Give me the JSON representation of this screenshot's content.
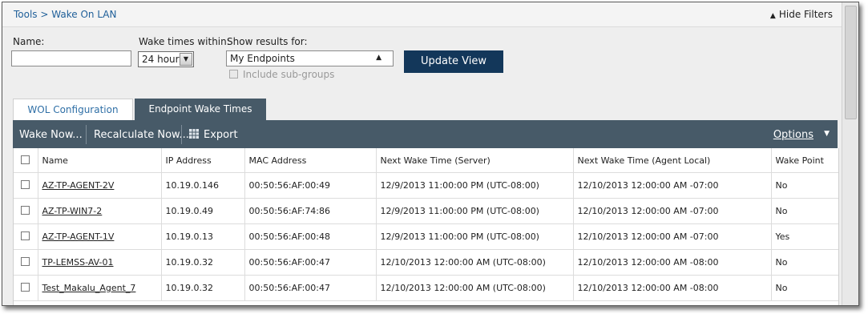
{
  "breadcrumb": {
    "parent": "Tools",
    "separator": ">",
    "current": "Wake On LAN"
  },
  "header": {
    "hide_filters_label": "Hide Filters"
  },
  "filters": {
    "name_label": "Name:",
    "name_value": "",
    "wake_times_label": "Wake times within:",
    "wake_times_value": "24 hours",
    "show_results_label": "Show results for:",
    "show_results_value": "My Endpoints",
    "include_subgroups_label": "Include sub-groups",
    "update_button_label": "Update View"
  },
  "tabs": [
    {
      "label": "WOL Configuration",
      "active": false
    },
    {
      "label": "Endpoint Wake Times",
      "active": true
    }
  ],
  "toolbar": {
    "wake_now_label": "Wake Now...",
    "recalculate_label": "Recalculate Now...",
    "export_label": "Export",
    "options_label": "Options"
  },
  "table": {
    "columns": [
      "Name",
      "IP Address",
      "MAC Address",
      "Next Wake Time (Server)",
      "Next Wake Time (Agent Local)",
      "Wake Point"
    ],
    "rows": [
      [
        "AZ-TP-AGENT-2V",
        "10.19.0.146",
        "00:50:56:AF:00:49",
        "12/9/2013 11:00:00 PM (UTC-08:00)",
        "12/10/2013 12:00:00 AM -07:00",
        "No"
      ],
      [
        "AZ-TP-WIN7-2",
        "10.19.0.49",
        "00:50:56:AF:74:86",
        "12/9/2013 11:00:00 PM (UTC-08:00)",
        "12/10/2013 12:00:00 AM -07:00",
        "No"
      ],
      [
        "AZ-TP-AGENT-1V",
        "10.19.0.13",
        "00:50:56:AF:00:48",
        "12/9/2013 11:00:00 PM (UTC-08:00)",
        "12/10/2013 12:00:00 AM -07:00",
        "Yes"
      ],
      [
        "TP-LEMSS-AV-01",
        "10.19.0.32",
        "00:50:56:AF:00:47",
        "12/10/2013 12:00:00 AM (UTC-08:00)",
        "12/10/2013 12:00:00 AM -08:00",
        "No"
      ],
      [
        "Test_Makalu_Agent_7",
        "10.19.0.32",
        "00:50:56:AF:00:47",
        "12/10/2013 12:00:00 AM (UTC-08:00)",
        "12/10/2013 12:00:00 AM -08:00",
        "No"
      ]
    ]
  },
  "colors": {
    "toolbar_bg": "#475a68",
    "button_bg": "#13375a",
    "link": "#1f5f99"
  }
}
